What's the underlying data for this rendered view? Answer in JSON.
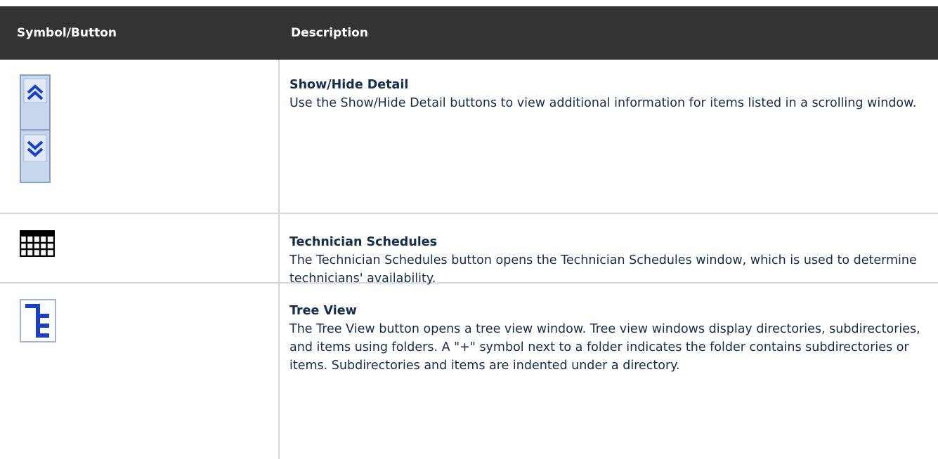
{
  "table": {
    "headers": {
      "symbol": "Symbol/Button",
      "description": "Description"
    },
    "rows": [
      {
        "icon": "show-hide-detail-icon",
        "title": "Show/Hide Detail",
        "text": "Use the Show/Hide Detail buttons to view additional information for items listed in a scrolling window."
      },
      {
        "icon": "grid-calendar-icon",
        "title": "Technician Schedules",
        "text": "The Technician Schedules button opens the Technician Schedules window, which is used to determine technicians' availability."
      },
      {
        "icon": "tree-view-icon",
        "title": "Tree View",
        "text": "The Tree View button opens a tree view window. Tree view windows display directories, subdirectories, and items using folders. A \"+\" symbol next to a folder indicates the folder contains subdirectories or items. Subdirectories and items are indented under a directory."
      }
    ]
  },
  "colors": {
    "header_bg": "#333333",
    "header_text": "#ffffff",
    "body_text": "#172b4d",
    "divider": "#d6d6d6",
    "icon_blue": "#1a3fcf"
  }
}
